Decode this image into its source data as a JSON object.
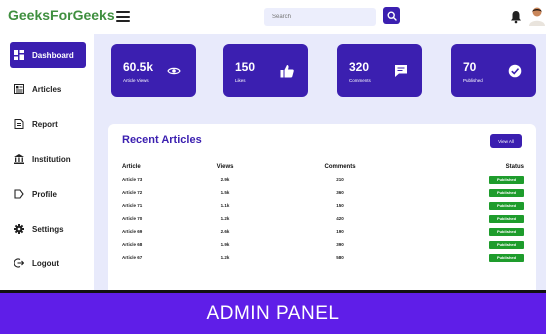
{
  "header": {
    "brand": "GeeksForGeeks",
    "search_placeholder": "Search"
  },
  "sidebar": {
    "items": [
      {
        "label": "Dashboard",
        "icon": "dashboard-icon",
        "active": true
      },
      {
        "label": "Articles",
        "icon": "articles-icon",
        "active": false
      },
      {
        "label": "Report",
        "icon": "report-icon",
        "active": false
      },
      {
        "label": "Institution",
        "icon": "institution-icon",
        "active": false
      },
      {
        "label": "Profile",
        "icon": "profile-icon",
        "active": false
      },
      {
        "label": "Settings",
        "icon": "settings-icon",
        "active": false
      },
      {
        "label": "Logout",
        "icon": "logout-icon",
        "active": false
      }
    ]
  },
  "stats": [
    {
      "value": "60.5k",
      "label": "Article Views",
      "icon": "eye-icon"
    },
    {
      "value": "150",
      "label": "Likes",
      "icon": "thumbs-up-icon"
    },
    {
      "value": "320",
      "label": "Comments",
      "icon": "comment-icon"
    },
    {
      "value": "70",
      "label": "Published",
      "icon": "check-circle-icon"
    }
  ],
  "recent": {
    "title": "Recent Articles",
    "view_all_label": "View All",
    "columns": [
      "Article",
      "Views",
      "Comments",
      "Status"
    ],
    "rows": [
      {
        "article": "Article 73",
        "views": "2.9k",
        "comments": "210",
        "status": "Published"
      },
      {
        "article": "Article 72",
        "views": "1.5k",
        "comments": "360",
        "status": "Published"
      },
      {
        "article": "Article 71",
        "views": "1.1k",
        "comments": "150",
        "status": "Published"
      },
      {
        "article": "Article 70",
        "views": "1.2k",
        "comments": "420",
        "status": "Published"
      },
      {
        "article": "Article 69",
        "views": "2.6k",
        "comments": "190",
        "status": "Published"
      },
      {
        "article": "Article 68",
        "views": "1.9k",
        "comments": "390",
        "status": "Published"
      },
      {
        "article": "Article 67",
        "views": "1.2k",
        "comments": "580",
        "status": "Published"
      }
    ]
  },
  "banner": {
    "text": "ADMIN PANEL"
  },
  "colors": {
    "accent": "#3b1fb0",
    "brand_green": "#3f8f3f",
    "published_green": "#1e9c2c",
    "banner_purple": "#5f1ee8",
    "main_bg": "#e8eafb"
  }
}
